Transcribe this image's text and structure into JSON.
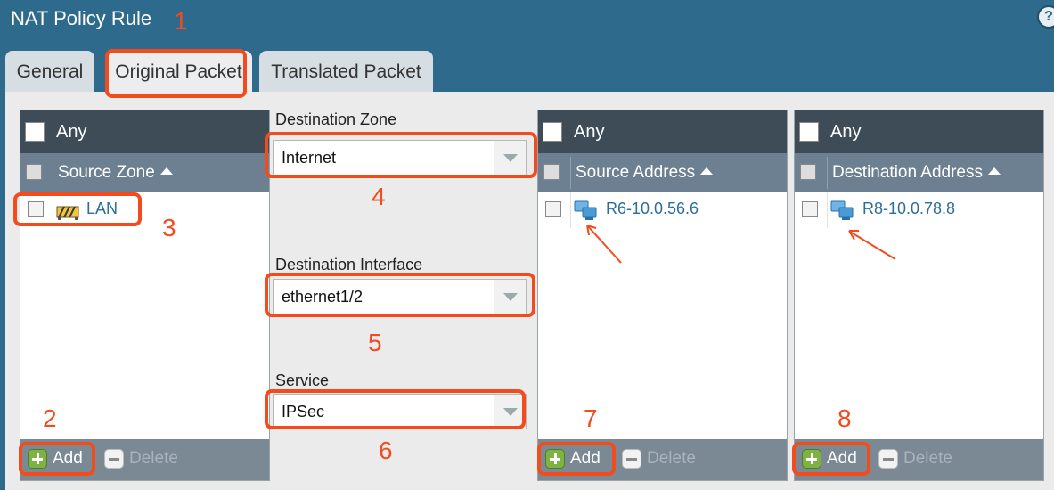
{
  "window": {
    "title": "NAT Policy Rule",
    "help_glyph": "?"
  },
  "tabs": [
    {
      "label": "General",
      "active": false
    },
    {
      "label": "Original Packet",
      "active": true
    },
    {
      "label": "Translated Packet",
      "active": false
    }
  ],
  "source_zone": {
    "any_label": "Any",
    "header": "Source Zone",
    "rows": [
      {
        "label": "LAN",
        "icon": "zone-icon"
      }
    ]
  },
  "destination_zone": {
    "label": "Destination Zone",
    "value": "Internet"
  },
  "destination_interface": {
    "label": "Destination Interface",
    "value": "ethernet1/2"
  },
  "service": {
    "label": "Service",
    "value": "IPSec"
  },
  "source_address": {
    "any_label": "Any",
    "header": "Source Address",
    "rows": [
      {
        "label": "R6-10.0.56.6",
        "icon": "address-object-icon"
      }
    ]
  },
  "destination_address": {
    "any_label": "Any",
    "header": "Destination Address",
    "rows": [
      {
        "label": "R8-10.0.78.8",
        "icon": "address-object-icon"
      }
    ]
  },
  "grid_actions": {
    "add_label": "Add",
    "delete_label": "Delete"
  },
  "annotations": {
    "n1": "1",
    "n2": "2",
    "n3": "3",
    "n4": "4",
    "n5": "5",
    "n6": "6",
    "n7": "7",
    "n8": "8"
  },
  "colors": {
    "accent_annotation": "#f24b1e",
    "header_dark": "#3d4c57",
    "header_column": "#6d8091",
    "link": "#2b6d9c"
  }
}
